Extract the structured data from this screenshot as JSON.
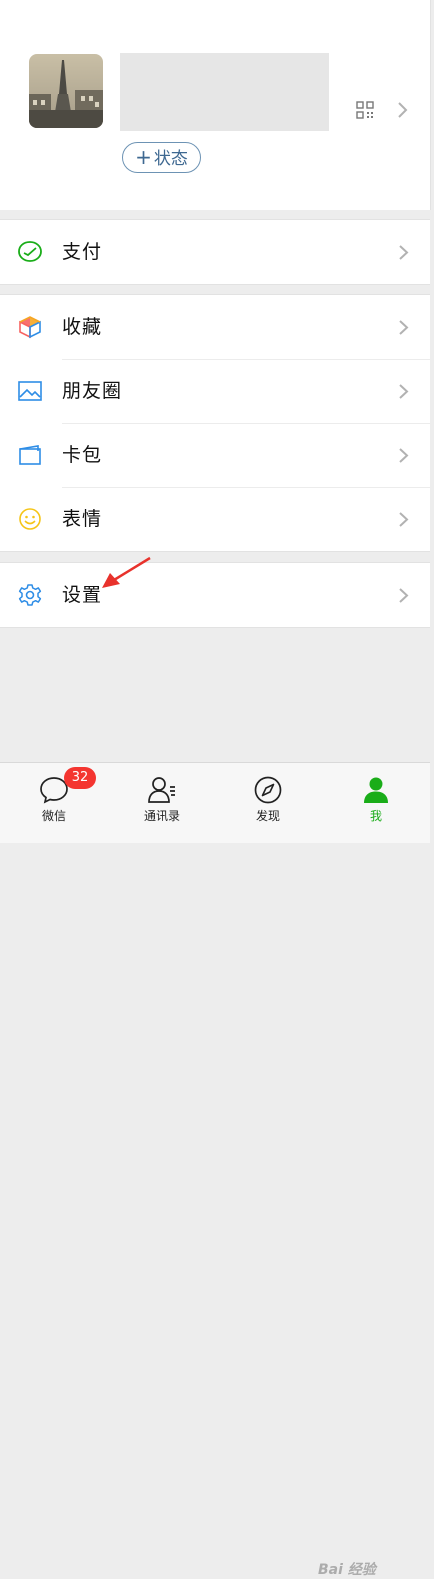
{
  "profile": {
    "status_label": "状态",
    "status_plus": "+"
  },
  "menu": {
    "pay": "支付",
    "favorites": "收藏",
    "moments": "朋友圈",
    "cards": "卡包",
    "stickers": "表情",
    "settings": "设置"
  },
  "tabbar": {
    "chats": "微信",
    "chats_badge": "32",
    "contacts": "通讯录",
    "discover": "发现",
    "me": "我"
  },
  "watermark": "Bai 经验",
  "colors": {
    "accent": "#1aad19",
    "badge": "#f43530",
    "status_border": "#6d93b4",
    "annotation_arrow": "#e8322c"
  }
}
